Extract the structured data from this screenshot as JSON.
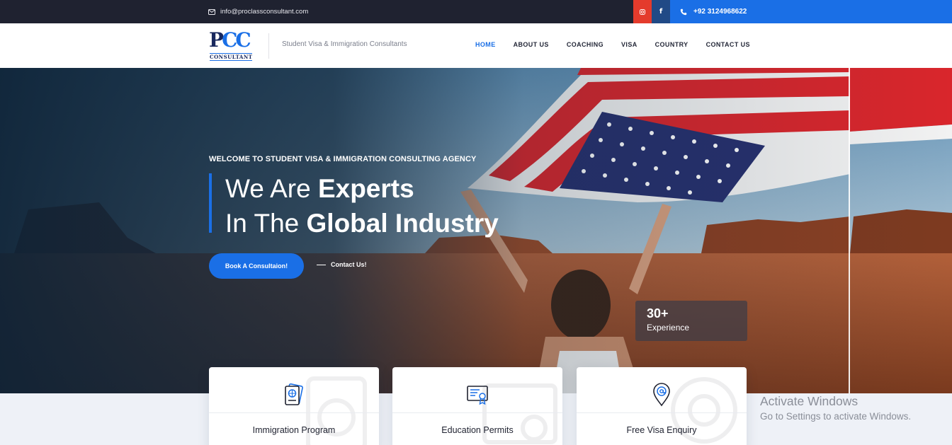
{
  "topbar": {
    "email": "info@proclassconsultant.com",
    "phone": "+92 3124968622",
    "icons": {
      "email": "mail-icon",
      "instagram": "instagram-icon",
      "facebook": "facebook-icon",
      "phone": "phone-icon"
    },
    "colors": {
      "bg": "#1f2230",
      "instagram": "#e43b2c",
      "facebook": "#214a86",
      "phone_bg": "#1a6fe6"
    }
  },
  "header": {
    "logo": {
      "mark": "PCC",
      "sub": "CONSULTANT"
    },
    "tagline": "Student Visa & Immigration Consultants",
    "nav": [
      "HOME",
      "ABOUT US",
      "COACHING",
      "VISA",
      "COUNTRY",
      "CONTACT US"
    ],
    "active_nav": "HOME"
  },
  "hero": {
    "welcome": "WELCOME TO STUDENT VISA & IMMIGRATION CONSULTING AGENCY",
    "line1_regular": "We Are ",
    "line1_bold": "Experts",
    "line2_regular": "In The ",
    "line2_bold": "Global Industry",
    "book_button": "Book A Consultaion!",
    "contact_link": "Contact Us!",
    "experience_number": "30+",
    "experience_label": "Experience"
  },
  "services": [
    {
      "title": "Immigration Program",
      "icon": "passport-icon"
    },
    {
      "title": "Education Permits",
      "icon": "certificate-icon"
    },
    {
      "title": "Free Visa Enquiry",
      "icon": "location-pin-icon"
    }
  ],
  "watermark": {
    "line1": "Activate Windows",
    "line2": "Go to Settings to activate Windows."
  },
  "colors": {
    "accent": "#1a6fe6",
    "dark": "#1f2230"
  }
}
